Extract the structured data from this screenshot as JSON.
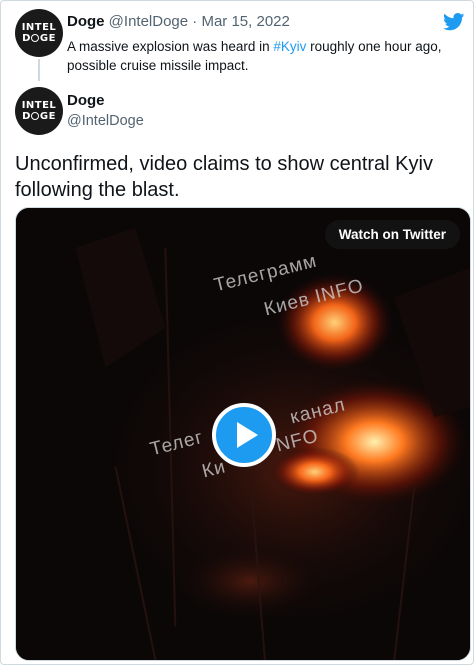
{
  "parent_tweet": {
    "avatar": {
      "line1": "INTEL",
      "line2_left": "D",
      "line2_right": "GE"
    },
    "author_name": "Doge",
    "author_handle": "@IntelDoge",
    "separator": "·",
    "date": "Mar 15, 2022",
    "text_before": "A massive explosion was heard in ",
    "hashtag": "#Kyiv",
    "text_after": " roughly one hour ago, possible cruise missile impact."
  },
  "main_tweet": {
    "avatar": {
      "line1": "INTEL",
      "line2_left": "D",
      "line2_right": "GE"
    },
    "author_name": "Doge",
    "author_handle": "@IntelDoge",
    "text": "Unconfirmed, video claims to show central Kyiv following the blast."
  },
  "media": {
    "watch_label": "Watch on Twitter",
    "watermark_top_1": "Телеграмм",
    "watermark_top_2": "Киев INFO",
    "watermark_mid_1": "Телег",
    "watermark_mid_2": "канал",
    "watermark_mid_3": "Ки",
    "watermark_mid_4": "NFO"
  },
  "icons": {
    "brand": "twitter-bird-icon",
    "play": "play-icon"
  },
  "colors": {
    "accent": "#1d9bf0",
    "muted": "#536471",
    "text": "#0f1419",
    "border": "#cfd9de"
  }
}
